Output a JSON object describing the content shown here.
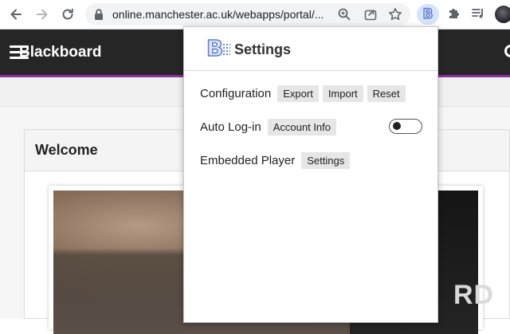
{
  "browser": {
    "url": "online.manchester.ac.uk/webapps/portal/...",
    "extension_letter": "B"
  },
  "page": {
    "site_title": "Blackboard",
    "welcome_heading": "Welcome",
    "banner_text_fragment": "RD"
  },
  "popup": {
    "logo_letter": "B",
    "title": "Settings",
    "rows": {
      "configuration": {
        "label": "Configuration",
        "buttons": [
          "Export",
          "Import",
          "Reset"
        ]
      },
      "auto_login": {
        "label": "Auto Log-in",
        "button": "Account Info",
        "toggle_on": false
      },
      "embedded_player": {
        "label": "Embedded Player",
        "button": "Settings"
      }
    }
  },
  "colors": {
    "header_bg": "#262626",
    "accent_purple": "#8a2f9b",
    "logo_blue": "#5b7bd5",
    "pill_bg": "#e6e6e6"
  }
}
